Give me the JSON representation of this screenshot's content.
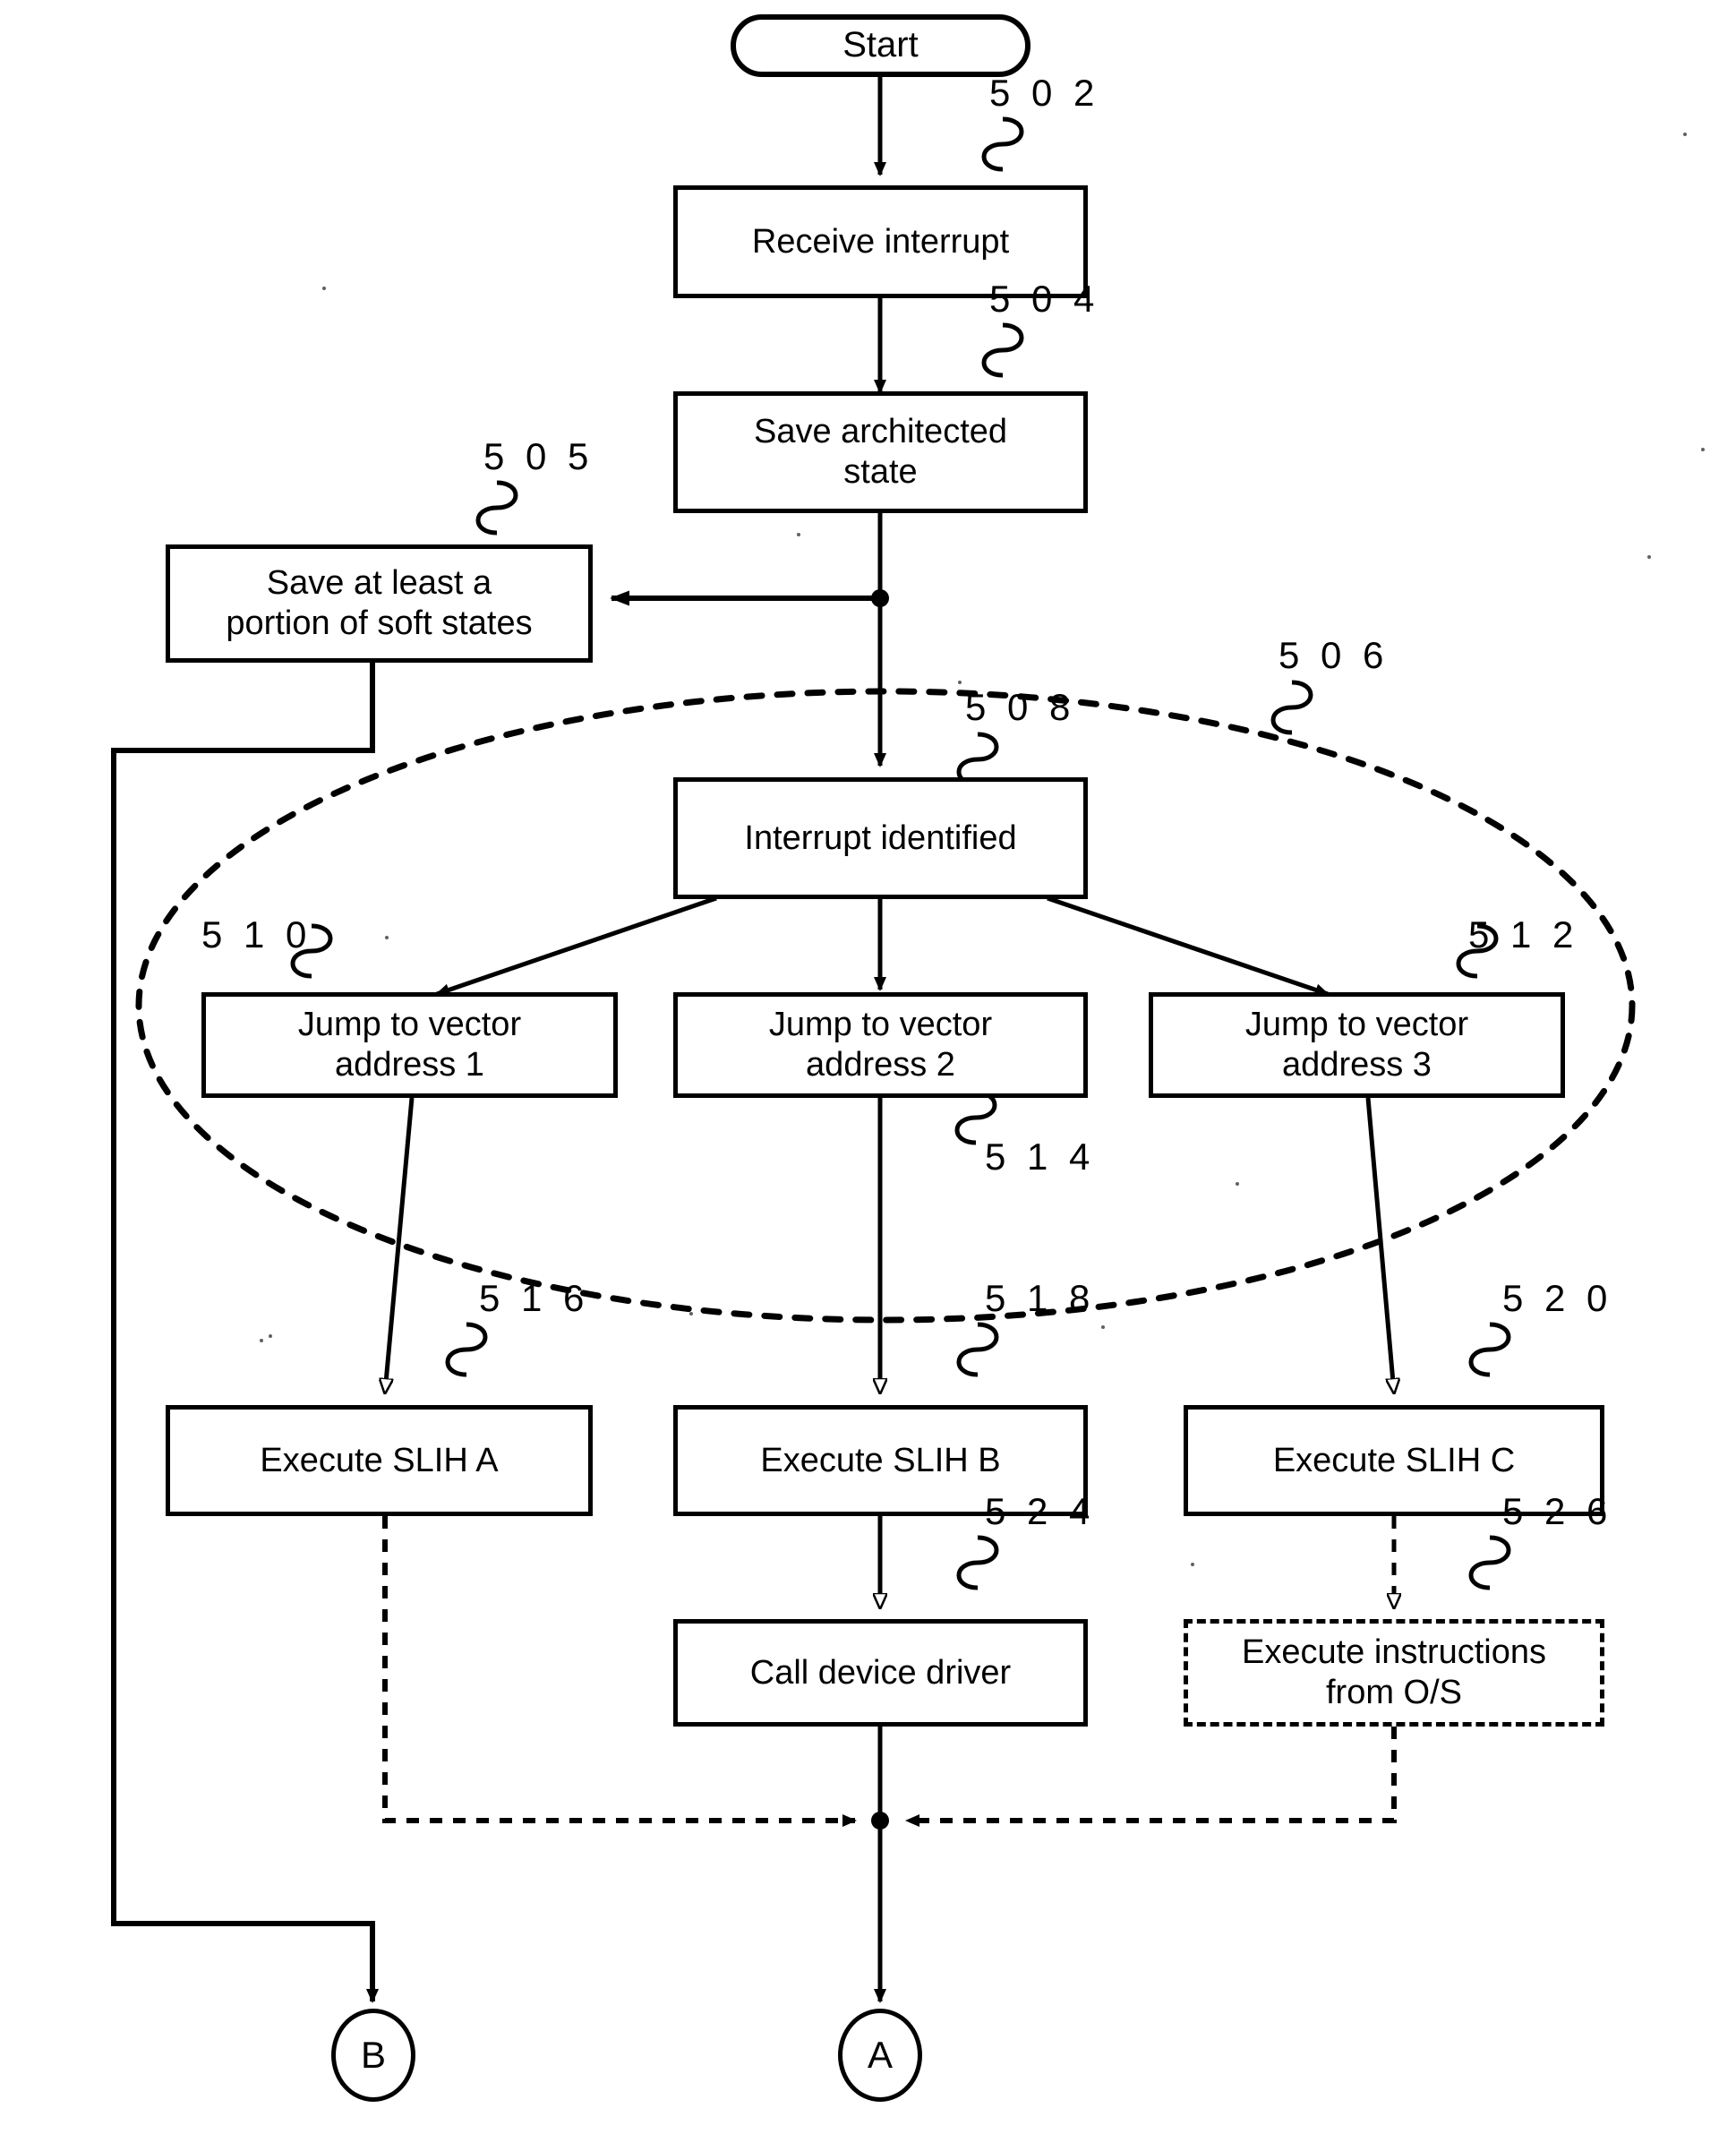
{
  "figure": {
    "kind": "patent-flowchart",
    "nodes": [
      {
        "id": "start",
        "label": "Start",
        "ref": ""
      },
      {
        "id": "n502",
        "label": "Receive interrupt",
        "ref": "5 0 2"
      },
      {
        "id": "n504",
        "label": "Save architected\nstate",
        "ref": "5 0 4"
      },
      {
        "id": "n505",
        "label": "Save at least a\nportion of soft states",
        "ref": "5 0 5"
      },
      {
        "id": "n508",
        "label": "Interrupt identified",
        "ref": "5 0 8"
      },
      {
        "id": "n510",
        "label": "Jump to vector\naddress 1",
        "ref": "5 1 0"
      },
      {
        "id": "n514",
        "label": "Jump to vector\naddress 2",
        "ref": "5 1 4"
      },
      {
        "id": "n512",
        "label": "Jump to vector\naddress 3",
        "ref": "5 1 2"
      },
      {
        "id": "n516",
        "label": "Execute SLIH A",
        "ref": "5 1 6"
      },
      {
        "id": "n518",
        "label": "Execute SLIH B",
        "ref": "5 1 8"
      },
      {
        "id": "n520",
        "label": "Execute SLIH C",
        "ref": "5 2 0"
      },
      {
        "id": "n524",
        "label": "Call device driver",
        "ref": "5 2 4"
      },
      {
        "id": "n526",
        "label": "Execute instructions\nfrom O/S",
        "ref": "5 2 6"
      },
      {
        "id": "connB",
        "label": "B",
        "ref": ""
      },
      {
        "id": "connA",
        "label": "A",
        "ref": ""
      }
    ],
    "groups": [
      {
        "id": "g506",
        "label": "",
        "ref": "5 0 6",
        "shape": "dashed-ellipse"
      }
    ],
    "colors": {
      "ink": "#000000",
      "paper": "#ffffff"
    }
  }
}
